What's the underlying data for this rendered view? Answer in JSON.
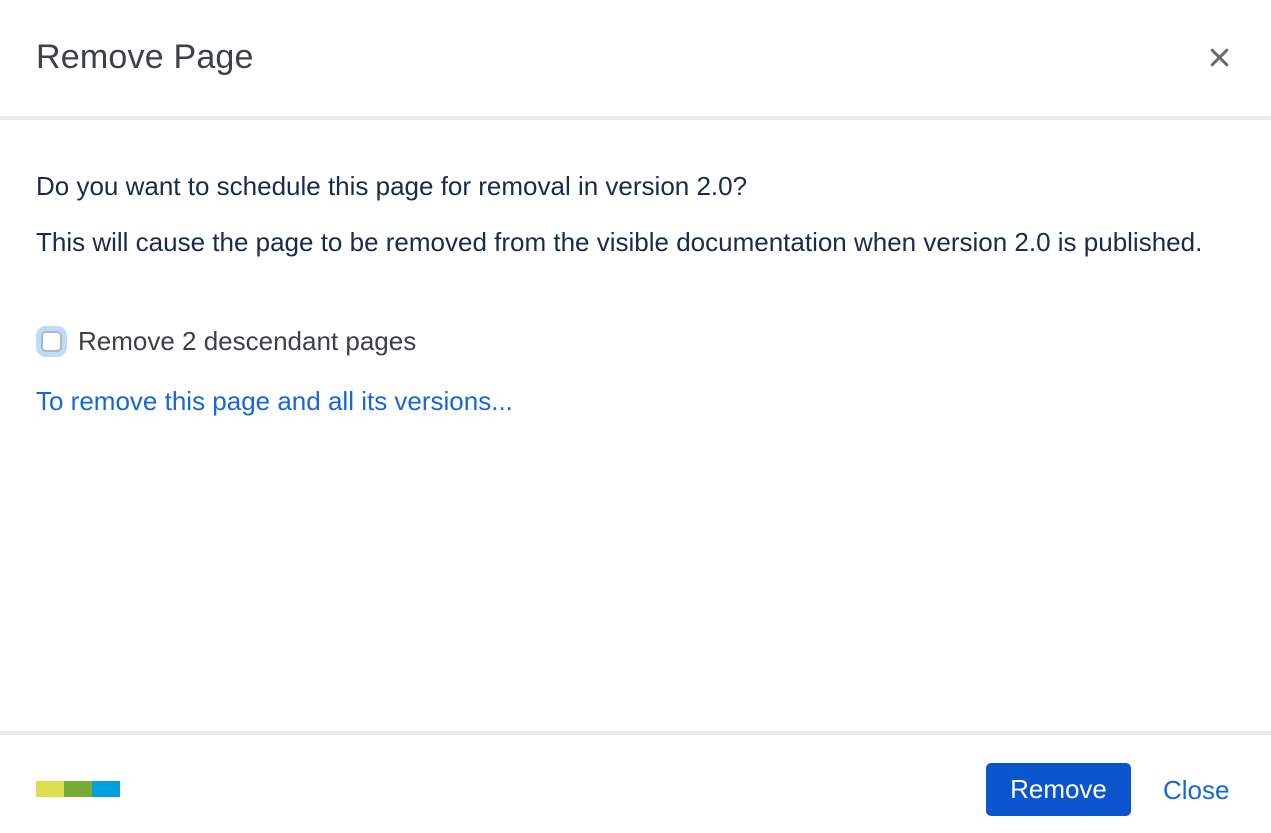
{
  "dialog": {
    "title": "Remove Page"
  },
  "content": {
    "question": "Do you want to schedule this page for removal in version 2.0?",
    "description": "This will cause the page to be removed from the visible documentation when version 2.0 is published.",
    "checkbox": {
      "label": "Remove 2 descendant pages",
      "checked": false
    },
    "versions_link": "To remove this page and all its versions..."
  },
  "footer": {
    "remove_button": "Remove",
    "close_link": "Close",
    "logo": {
      "name": "brand-logo",
      "colors": [
        "#dce04e",
        "#76ae35",
        "#009fe0"
      ]
    }
  },
  "colors": {
    "primary_button": "#0b55cf",
    "link_blue": "#1767da",
    "body_text": "#172b4d",
    "title_text": "#3e4247",
    "divider": "#e9ebee",
    "checkbox_focus_ring": "#bedbf8",
    "close_icon": "#66696e"
  }
}
